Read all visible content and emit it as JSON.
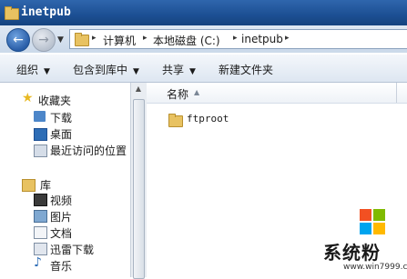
{
  "window": {
    "title": "inetpub"
  },
  "address": {
    "back": "←",
    "forward": "→",
    "crumbs": [
      "计算机",
      "本地磁盘 (C:)",
      "inetpub"
    ]
  },
  "toolbar": {
    "organize": "组织",
    "include_library": "包含到库中",
    "share": "共享",
    "new_folder": "新建文件夹",
    "dropdown_glyph": "▼"
  },
  "navpane": {
    "favorites": {
      "label": "收藏夹",
      "items": [
        "下载",
        "桌面",
        "最近访问的位置"
      ]
    },
    "libraries": {
      "label": "库",
      "items": [
        "视频",
        "图片",
        "文档",
        "迅雷下载",
        "音乐"
      ]
    }
  },
  "content": {
    "column_name": "名称",
    "files": [
      {
        "name": "ftproot",
        "type": "folder"
      }
    ]
  },
  "watermark": {
    "text": "系统粉",
    "url": "www.win7999.com"
  },
  "colors": {
    "titlebar": "#1c4f93",
    "ms_red": "#f25022",
    "ms_green": "#7fba00",
    "ms_blue": "#00a4ef",
    "ms_yellow": "#ffb900"
  }
}
